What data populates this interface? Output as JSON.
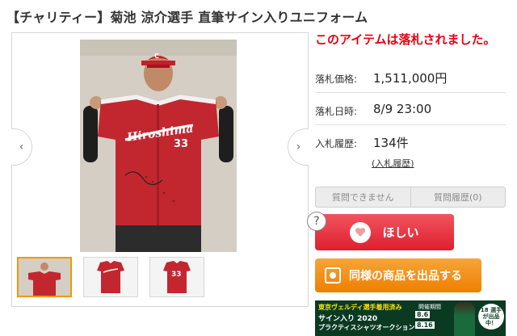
{
  "item": {
    "title": "【チャリティー】菊池 涼介選手 直筆サイン入りユニフォーム"
  },
  "gallery": {
    "jersey_text": "Hiroshima",
    "jersey_number": "33",
    "cap_letter": "C",
    "thumb_number": "33",
    "thumb_count": 3,
    "active_thumb_index": 0
  },
  "status": {
    "sold_message": "このアイテムは落札されました。"
  },
  "details": {
    "price_label": "落札価格:",
    "price_value": "1,511,000円",
    "end_label": "落札日時:",
    "end_value": "8/9 23:00",
    "bids_label": "入札履歴:",
    "bids_value": "134件",
    "bids_link": "(入札履歴)"
  },
  "questions": {
    "ask_label": "質問できません",
    "history_label": "質問履歴(0)"
  },
  "actions": {
    "want_label": "ほしい",
    "help_label": "?",
    "sell_similar_label": "同様の商品を出品する"
  },
  "banner": {
    "line1": "東京ヴェルディ選手着用済み",
    "line2": "サイン入り 2020",
    "line3": "プラクティスシャツオークション",
    "period_label": "開催期間",
    "date_start": "8.6",
    "date_end": "8.16",
    "badge_text": "18 選手が出品中！"
  },
  "colors": {
    "accent_red": "#e60012",
    "want_red": "#e01e2e",
    "orange": "#ee7f00",
    "banner_green": "#0b3a23"
  }
}
